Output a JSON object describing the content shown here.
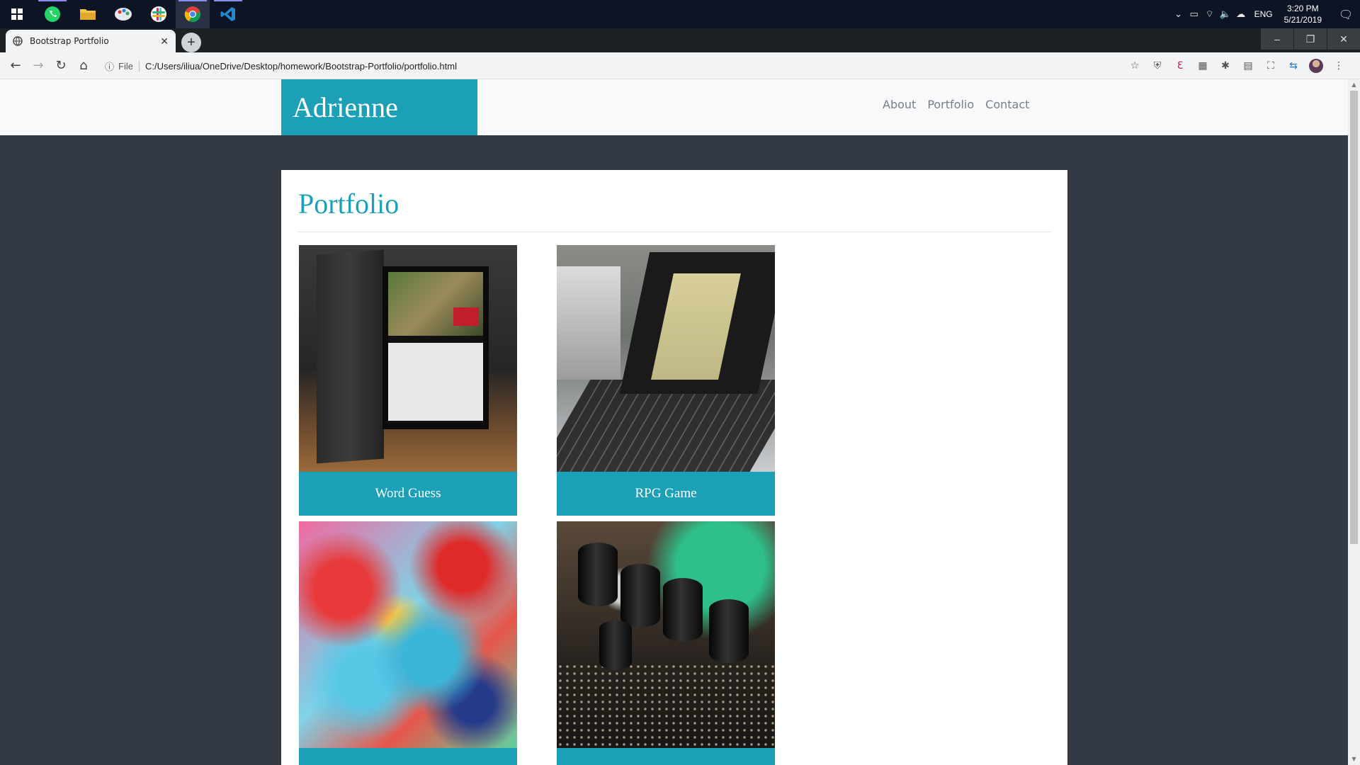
{
  "taskbar": {
    "apps": [
      {
        "name": "start",
        "icon": "windows-icon"
      },
      {
        "name": "whatsapp",
        "icon": "whatsapp-icon"
      },
      {
        "name": "file-explorer",
        "icon": "folder-icon"
      },
      {
        "name": "paint",
        "icon": "paint-icon"
      },
      {
        "name": "slack",
        "icon": "slack-icon"
      },
      {
        "name": "chrome",
        "icon": "chrome-icon"
      },
      {
        "name": "vscode",
        "icon": "vscode-icon"
      }
    ],
    "language": "ENG",
    "time": "3:20 PM",
    "date": "5/21/2019"
  },
  "browser": {
    "tab_title": "Bootstrap Portfolio",
    "url_scheme_label": "File",
    "url": "C:/Users/iliua/OneDrive/Desktop/homework/Bootstrap-Portfolio/portfolio.html"
  },
  "site": {
    "brand": "Adrienne",
    "nav": [
      "About",
      "Portfolio",
      "Contact"
    ],
    "page_title": "Portfolio",
    "projects": [
      {
        "label": "Word Guess",
        "image": "tablet-photo"
      },
      {
        "label": "RPG Game",
        "image": "laptop-photo"
      },
      {
        "label": "",
        "image": "abstract-paint-photo"
      },
      {
        "label": "",
        "image": "capacitors-photo"
      }
    ]
  },
  "colors": {
    "accent": "#1ba0b8",
    "page_background": "#343a44",
    "navbar_background": "#f8f9fa",
    "taskbar": "#0d1424"
  }
}
